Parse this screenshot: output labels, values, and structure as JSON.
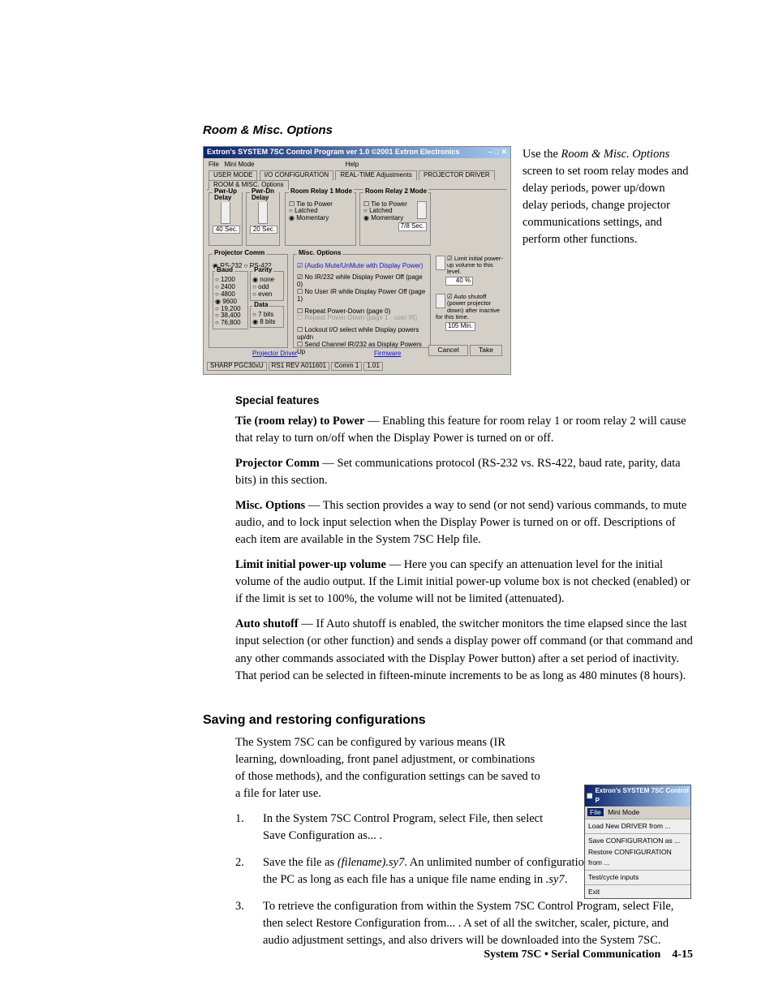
{
  "section1": {
    "title": "Room & Misc. Options",
    "window": {
      "title": "Extron's SYSTEM 7SC Control Program    ver 1.0   ©2001 Extron Electronics",
      "menubar": [
        "File",
        "Mini Mode",
        "Help"
      ],
      "tabs": [
        "USER MODE",
        "I/O CONFIGURATION",
        "REAL-TIME Adjustments",
        "PROJECTOR DRIVER",
        "ROOM & MISC. Options"
      ],
      "active_tab": 4,
      "pwrup": {
        "label": "Pwr-Up Delay",
        "value": "40 Sec."
      },
      "pwrdn": {
        "label": "Pwr-Dn Delay",
        "value": "20 Sec."
      },
      "relay1": {
        "label": "Room Relay 1 Mode",
        "tie": "Tie to Power",
        "latched": "Latched",
        "momentary": "Momentary",
        "mode": "momentary"
      },
      "relay2": {
        "label": "Room Relay 2 Mode",
        "tie": "Tie to Power",
        "latched": "Latched",
        "momentary": "Momentary",
        "mode": "momentary",
        "time": "7/8 Sec."
      },
      "projcomm": {
        "label": "Projector Comm",
        "rs232": "RS-232",
        "rs422": "RS-422",
        "baud_label": "Baud",
        "baud_opts": [
          "1200",
          "2400",
          "4800",
          "9600",
          "19,200",
          "38,400",
          "76,800"
        ],
        "baud_sel": "9600",
        "parity_label": "Parity",
        "parity_opts": [
          "none",
          "odd",
          "even"
        ],
        "parity_sel": "none",
        "data_label": "Data",
        "data_opts": [
          "7 bits",
          "8 bits"
        ],
        "data_sel": "8 bits"
      },
      "misc": {
        "label": "Misc. Options",
        "items": [
          {
            "txt": "(Audio Mute/UnMute with Display Power)",
            "on": true,
            "blue": true
          },
          {
            "txt": "No IR/232 while Display Power Off (page 0)",
            "on": true
          },
          {
            "txt": "No User IR while Display Power Off (page 1)",
            "on": false
          },
          {
            "txt": "Repeat Power-Down (page 0)",
            "on": false
          },
          {
            "txt": "Repeat Power-Down (page 1 - user IR)",
            "on": false,
            "dim": true
          },
          {
            "txt": "Lockout I/O select while Display powers up/dn",
            "on": false
          },
          {
            "txt": "Send Channel IR/232 as Display Powers Up",
            "on": false
          }
        ]
      },
      "limit": {
        "label": "Limit initial power-up volume to this level.",
        "value": "40 %"
      },
      "auto": {
        "label": "Auto shutoff (power projector down) after inactive for this time.",
        "value": "105 Min."
      },
      "links": {
        "drv": "Projector Driver",
        "fw": "Firmware"
      },
      "buttons": {
        "cancel": "Cancel",
        "take": "Take"
      },
      "status": {
        "model": "SHARP PGC30xU",
        "rev": "RS1 REV A011601",
        "comm": "Comm 1",
        "ver": "1.01"
      }
    },
    "caption_parts": {
      "a": "Use the ",
      "b": "Room & Misc. Options",
      "c": " screen to set room relay modes and delay periods, power up/down delay periods, change projector communications settings, and perform other functions."
    }
  },
  "special": {
    "title": "Special features",
    "items": [
      {
        "term": "Tie (room relay) to Power",
        "body": " — Enabling this feature for room relay 1 or room relay 2 will cause that relay to turn on/off when the Display Power is turned on or off."
      },
      {
        "term": "Projector Comm",
        "body": " — Set communications protocol (RS-232 vs. RS-422, baud rate, parity, data bits) in this section."
      },
      {
        "term": "Misc. Options",
        "body": " — This section provides a way to send (or not send) various commands, to mute audio, and to lock input selection when the Display Power is turned on or off.  Descriptions of each item are available in the System 7SC Help file."
      },
      {
        "term": "Limit initial power-up volume",
        "body": " — Here you can specify an attenuation level for the initial volume of the audio output.  If the Limit initial power-up volume box is not checked (enabled) or if the limit is set to 100%, the volume will not be limited (attenuated)."
      },
      {
        "term": "Auto shutoff",
        "body": " — If Auto shutoff is enabled, the switcher monitors the time elapsed since the last input selection (or other function) and sends a display power off command (or that command and any other commands  associated with the Display Power button) after a set period of inactivity.  That period can be selected in fifteen-minute increments to be as long as 480 minutes (8 hours)."
      }
    ]
  },
  "saving": {
    "title": "Saving and restoring configurations",
    "intro": "The System 7SC can be configured by various means (IR learning, downloading, front panel adjustment, or combinations of those methods), and the configuration settings can be saved to a file for later use.",
    "steps": [
      "In the System 7SC Control Program, select File, then select Save Configuration as... .",
      {
        "pre": "Save the file as ",
        "ital": "(filename).sy7",
        "mid": ".  An unlimited number of configuration files can be saved on the PC as long as each file has a unique file name ending in ",
        "ital2": ".sy7",
        "post": "."
      },
      "To retrieve the configuration from within the System 7SC Control Program, select File, then select Restore Configuration from... .  A  set of all the switcher, scaler, picture, and audio adjustment settings, and also drivers will be downloaded into the System 7SC."
    ],
    "menu": {
      "title": "Extron's SYSTEM 7SC Control P",
      "file": "File",
      "mini": "Mini Mode",
      "items": [
        "Load New DRIVER from ...",
        "Save CONFIGURATION  as ...",
        "Restore CONFIGURATION from ...",
        "Test/cycle inputs",
        "Exit"
      ]
    }
  },
  "footer": {
    "left": "System 7SC • Serial Communication",
    "right": "4-15"
  }
}
